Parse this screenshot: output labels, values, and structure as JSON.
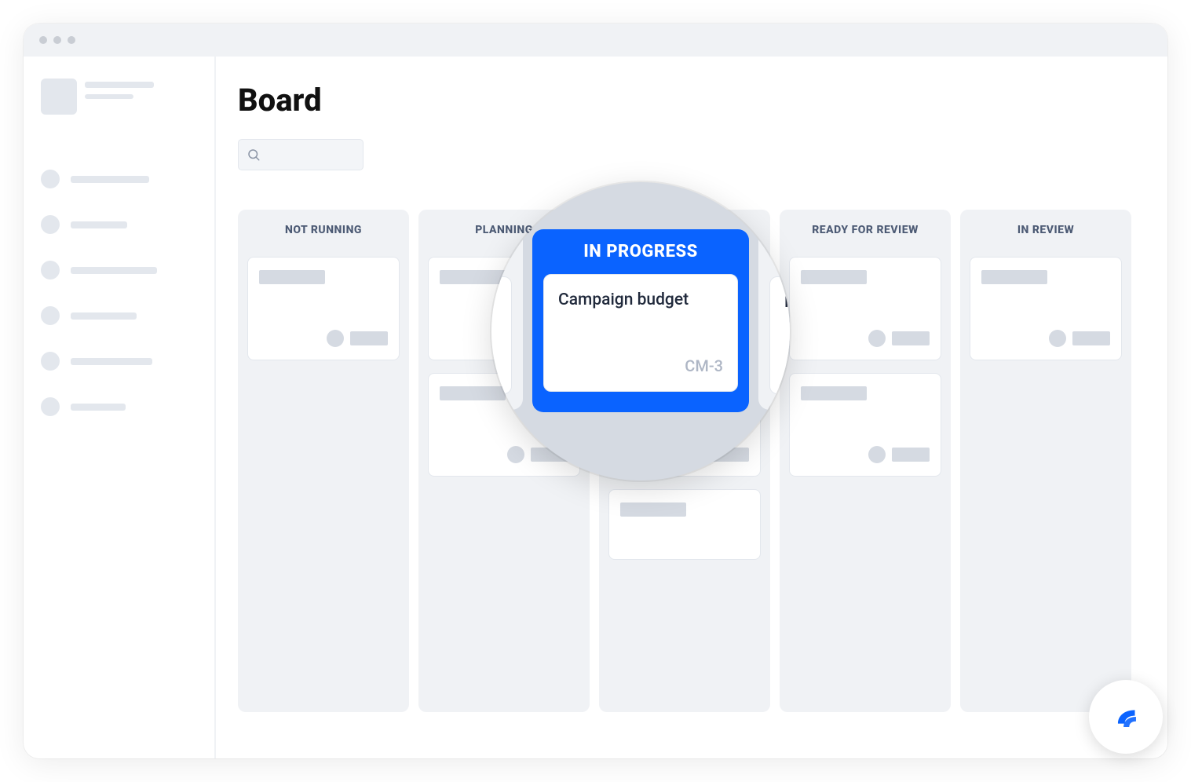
{
  "page": {
    "title": "Board"
  },
  "board": {
    "columns": [
      {
        "label": "NOT RUNNING",
        "card_count": 1
      },
      {
        "label": "PLANNING",
        "card_count": 2
      },
      {
        "label": "IN PROGRESS",
        "card_count": 3
      },
      {
        "label": "READY FOR REVIEW",
        "card_count": 2
      },
      {
        "label": "IN REVIEW",
        "card_count": 1
      }
    ]
  },
  "magnifier": {
    "column_label": "IN PROGRESS",
    "card": {
      "title": "Campaign budget",
      "id": "CM-3"
    },
    "right_partial_title": "R"
  },
  "sidebar": {
    "item_count": 6
  }
}
